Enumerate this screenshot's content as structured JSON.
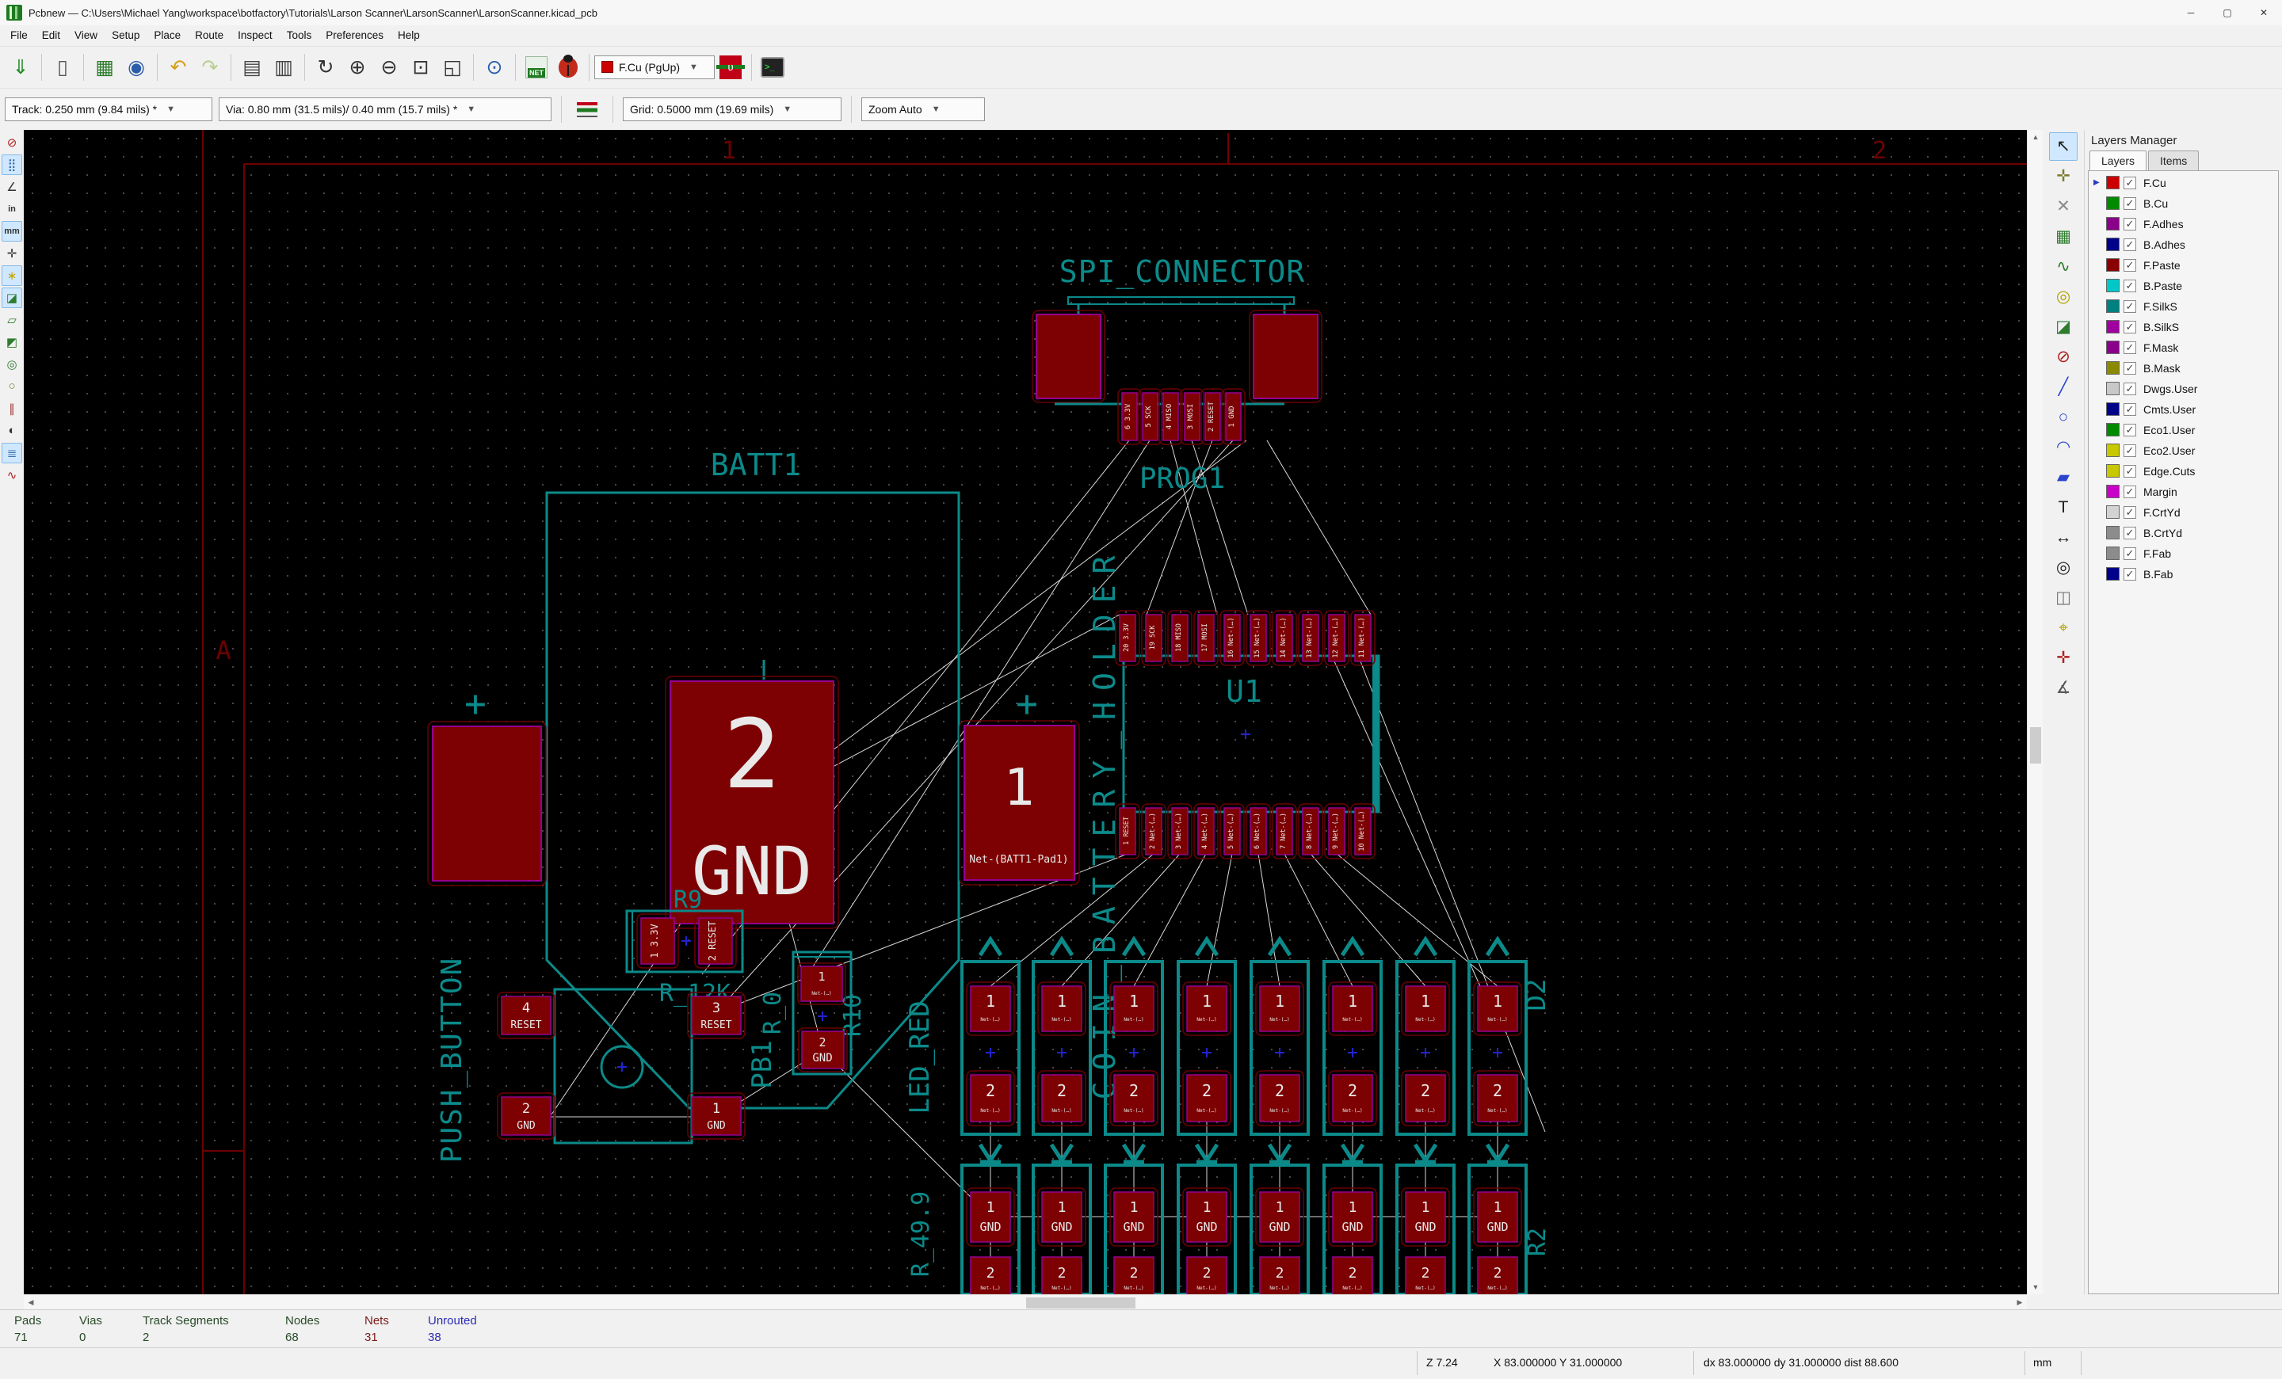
{
  "window": {
    "title": "Pcbnew — C:\\Users\\Michael Yang\\workspace\\botfactory\\Tutorials\\Larson Scanner\\LarsonScanner\\LarsonScanner.kicad_pcb",
    "minimize": "─",
    "maximize": "▢",
    "close": "✕"
  },
  "menu": [
    "File",
    "Edit",
    "View",
    "Setup",
    "Place",
    "Route",
    "Inspect",
    "Tools",
    "Preferences",
    "Help"
  ],
  "toolbar_main": {
    "icons_left": [
      {
        "name": "save-icon",
        "glyph": "⇓",
        "color": "#1f8a1f"
      },
      {
        "name": "page-settings-icon",
        "glyph": "▯",
        "color": "#555",
        "sep": true
      },
      {
        "name": "footprint-editor-icon",
        "glyph": "▦",
        "color": "#2e7d2e",
        "sep": true
      },
      {
        "name": "footprint-browser-icon",
        "glyph": "◉",
        "color": "#2a5caa"
      },
      {
        "name": "undo-icon",
        "glyph": "↶",
        "color": "#d4a017",
        "sep": true
      },
      {
        "name": "redo-icon",
        "glyph": "↷",
        "color": "#b9cf92"
      },
      {
        "name": "print-icon",
        "glyph": "▤",
        "color": "#444",
        "sep": true
      },
      {
        "name": "plot-icon",
        "glyph": "▥",
        "color": "#444"
      },
      {
        "name": "redraw-icon",
        "glyph": "↻",
        "color": "#333",
        "sep": true
      },
      {
        "name": "zoom-in-icon",
        "glyph": "⊕",
        "color": "#333"
      },
      {
        "name": "zoom-out-icon",
        "glyph": "⊖",
        "color": "#333"
      },
      {
        "name": "zoom-fit-icon",
        "glyph": "⊡",
        "color": "#333"
      },
      {
        "name": "zoom-selection-icon",
        "glyph": "◱",
        "color": "#333"
      },
      {
        "name": "find-icon",
        "glyph": "⊙",
        "color": "#2a5caa",
        "sep": true
      },
      {
        "name": "netlist-icon",
        "glyph": "NET",
        "special": "net",
        "sep": true
      },
      {
        "name": "drc-icon",
        "glyph": "",
        "special": "bug"
      }
    ],
    "layer_combo": "F.Cu (PgUp)",
    "icons_right": [
      {
        "name": "via-track-swap-icon",
        "glyph": "υ",
        "special": "via"
      },
      {
        "name": "scripting-console-icon",
        "glyph": ">_",
        "special": "console",
        "sep": true
      }
    ]
  },
  "toolbar_aux": {
    "track": "Track: 0.250 mm (9.84 mils) *",
    "via": "Via: 0.80 mm (31.5 mils)/ 0.40 mm (15.7 mils) *",
    "grid": "Grid: 0.5000 mm (19.69 mils)",
    "zoom": "Zoom Auto"
  },
  "left_toolbar": [
    {
      "name": "drc-off-icon",
      "glyph": "⊘",
      "color": "#b02020"
    },
    {
      "name": "grid-visibility-icon",
      "glyph": "⣿",
      "color": "#3a6ea5",
      "pressed": true
    },
    {
      "name": "polar-coords-icon",
      "glyph": "∠",
      "color": "#333"
    },
    {
      "name": "units-inch-icon",
      "glyph": "in",
      "color": "#333",
      "text": true
    },
    {
      "name": "units-mm-icon",
      "glyph": "mm",
      "color": "#333",
      "text": true,
      "pressed": true
    },
    {
      "name": "cursor-shape-icon",
      "glyph": "✛",
      "color": "#333"
    },
    {
      "name": "ratsnest-visibility-icon",
      "glyph": "∗",
      "color": "#c8a400",
      "pressed": true
    },
    {
      "name": "zones-filled-icon",
      "glyph": "◪",
      "color": "#2e7d2e",
      "pressed": true
    },
    {
      "name": "zones-outline-icon",
      "glyph": "▱",
      "color": "#2e7d2e"
    },
    {
      "name": "zones-sketch-icon",
      "glyph": "◩",
      "color": "#2e7d2e"
    },
    {
      "name": "pads-sketch-icon",
      "glyph": "◎",
      "color": "#2e7d2e"
    },
    {
      "name": "vias-sketch-icon",
      "glyph": "○",
      "color": "#7a7a2a"
    },
    {
      "name": "tracks-sketch-icon",
      "glyph": "∥",
      "color": "#a03030"
    },
    {
      "name": "high-contrast-icon",
      "glyph": "◐",
      "color": "#333"
    },
    {
      "name": "layers-panel-toggle-icon",
      "glyph": "≣",
      "color": "#3a6ea5",
      "pressed": true
    },
    {
      "name": "microwave-tools-icon",
      "glyph": "∿",
      "color": "#b02020"
    }
  ],
  "right_toolbar": [
    {
      "name": "select-tool-icon",
      "glyph": "↖",
      "color": "#222",
      "pressed": true
    },
    {
      "name": "highlight-net-icon",
      "glyph": "✛",
      "color": "#7a7a2a"
    },
    {
      "name": "local-ratsnest-icon",
      "glyph": "✕",
      "color": "#888"
    },
    {
      "name": "add-footprint-icon",
      "glyph": "▦",
      "color": "#2e7d2e"
    },
    {
      "name": "route-tracks-icon",
      "glyph": "∿",
      "color": "#2e7d2e"
    },
    {
      "name": "add-via-icon",
      "glyph": "◎",
      "color": "#b0a000"
    },
    {
      "name": "add-zone-icon",
      "glyph": "◪",
      "color": "#2e7d2e"
    },
    {
      "name": "add-keepout-icon",
      "glyph": "⊘",
      "color": "#b02020"
    },
    {
      "name": "add-graphic-line-icon",
      "glyph": "╱",
      "color": "#2a44cc"
    },
    {
      "name": "add-circle-icon",
      "glyph": "○",
      "color": "#2a44cc"
    },
    {
      "name": "add-arc-icon",
      "glyph": "◠",
      "color": "#2a44cc"
    },
    {
      "name": "add-polygon-icon",
      "glyph": "▰",
      "color": "#2a44cc"
    },
    {
      "name": "add-text-icon",
      "glyph": "T",
      "color": "#222"
    },
    {
      "name": "add-dimension-icon",
      "glyph": "↔",
      "color": "#222"
    },
    {
      "name": "add-target-icon",
      "glyph": "◎",
      "color": "#222"
    },
    {
      "name": "delete-tool-icon",
      "glyph": "◫",
      "color": "#777"
    },
    {
      "name": "drill-origin-icon",
      "glyph": "⌖",
      "color": "#b0a000"
    },
    {
      "name": "grid-origin-icon",
      "glyph": "✛",
      "color": "#b02020"
    },
    {
      "name": "measure-tool-icon",
      "glyph": "∡",
      "color": "#555"
    }
  ],
  "layers_manager": {
    "title": "Layers Manager",
    "tabs": [
      "Layers",
      "Items"
    ],
    "active_tab": "Layers",
    "check": "✓",
    "layers": [
      {
        "name": "F.Cu",
        "color": "#cc0000",
        "checked": true,
        "selected": true
      },
      {
        "name": "B.Cu",
        "color": "#008a00",
        "checked": true
      },
      {
        "name": "F.Adhes",
        "color": "#8a008a",
        "checked": true
      },
      {
        "name": "B.Adhes",
        "color": "#00008a",
        "checked": true
      },
      {
        "name": "F.Paste",
        "color": "#8a0000",
        "checked": true
      },
      {
        "name": "B.Paste",
        "color": "#00c8c8",
        "checked": true
      },
      {
        "name": "F.SilkS",
        "color": "#008080",
        "checked": true
      },
      {
        "name": "B.SilkS",
        "color": "#a000a0",
        "checked": true
      },
      {
        "name": "F.Mask",
        "color": "#8a008a",
        "checked": true
      },
      {
        "name": "B.Mask",
        "color": "#8a8a00",
        "checked": true
      },
      {
        "name": "Dwgs.User",
        "color": "#c8c8c8",
        "checked": true
      },
      {
        "name": "Cmts.User",
        "color": "#00008a",
        "checked": true
      },
      {
        "name": "Eco1.User",
        "color": "#008a00",
        "checked": true
      },
      {
        "name": "Eco2.User",
        "color": "#c8c800",
        "checked": true
      },
      {
        "name": "Edge.Cuts",
        "color": "#c8c800",
        "checked": true
      },
      {
        "name": "Margin",
        "color": "#c800c8",
        "checked": true
      },
      {
        "name": "F.CrtYd",
        "color": "#d3d3d3",
        "checked": true
      },
      {
        "name": "B.CrtYd",
        "color": "#8c8c8c",
        "checked": true
      },
      {
        "name": "F.Fab",
        "color": "#8c8c8c",
        "checked": true
      },
      {
        "name": "B.Fab",
        "color": "#00008a",
        "checked": true
      }
    ]
  },
  "canvas": {
    "sheet": {
      "col1": "1",
      "col2": "2",
      "row": "A"
    },
    "spi": {
      "title": "SPI_CONNECTOR",
      "ref": "PROG1",
      "pads": [
        "6 3.3V",
        "5 SCK",
        "4 MISO",
        "3 MOSI",
        "2 RESET",
        "1 GND"
      ]
    },
    "batt": {
      "ref": "BATT1",
      "holder": "COIN_BATTERY_HOLDER",
      "plus": "+",
      "pad2_num": "2",
      "pad2_name": "GND",
      "pad1_num": "1",
      "pad1_net": "Net-(BATT1-Pad1)"
    },
    "u1": {
      "ref": "U1",
      "top_pads": [
        [
          "20",
          "3.3V"
        ],
        [
          "19",
          "SCK"
        ],
        [
          "18",
          "MISO"
        ],
        [
          "17",
          "MOSI"
        ],
        [
          "16",
          "Net-(…)"
        ],
        [
          "15",
          "Net-(…)"
        ],
        [
          "14",
          "Net-(…)"
        ],
        [
          "13",
          "Net-(…)"
        ],
        [
          "12",
          "Net-(…)"
        ],
        [
          "11",
          "Net-(…)"
        ]
      ],
      "bottom_pads": [
        [
          "1",
          "RESET"
        ],
        [
          "2",
          "Net-(…)"
        ],
        [
          "3",
          "Net-(…)"
        ],
        [
          "4",
          "Net-(…)"
        ],
        [
          "5",
          "Net-(…)"
        ],
        [
          "6",
          "Net-(…)"
        ],
        [
          "7",
          "Net-(…)"
        ],
        [
          "8",
          "Net-(…)"
        ],
        [
          "9",
          "Net-(…)"
        ],
        [
          "10",
          "Net-(…)"
        ]
      ]
    },
    "r9": {
      "ref": "R9",
      "value": "R_12K",
      "pad1": "1 3.3V",
      "pad2": "2 RESET"
    },
    "button": {
      "label": "PUSH_BUTTON",
      "pads": [
        [
          "4",
          "RESET"
        ],
        [
          "3",
          "RESET"
        ],
        [
          "2",
          "GND"
        ],
        [
          "1",
          "GND"
        ]
      ]
    },
    "r10": {
      "ref": "R10",
      "value": "R_0",
      "pb": "PB1",
      "pad1_num": "1",
      "pad1_net": "Net-(…)",
      "pad2_num": "2",
      "pad2_name": "GND"
    },
    "led_row": {
      "label": "LED_RED",
      "right_label": "D2",
      "count": 8,
      "pad1_num": "1",
      "pad1_net": "Net-(…)",
      "pad2_num": "2",
      "pad2_net": "Net-(…)"
    },
    "res_row": {
      "label": "R_49.9",
      "right_label": "R2",
      "count": 8,
      "pad1_num": "1",
      "pad1_name": "GND",
      "pad2_num": "2",
      "pad2_net": "Net-(…)"
    }
  },
  "status_panel": {
    "items": [
      {
        "label": "Pads",
        "value": "71",
        "color": "#294a29"
      },
      {
        "label": "Vias",
        "value": "0",
        "color": "#294a29"
      },
      {
        "label": "Track Segments",
        "value": "2",
        "color": "#294a29"
      },
      {
        "label": "Nodes",
        "value": "68",
        "color": "#294a29"
      },
      {
        "label": "Nets",
        "value": "31",
        "color": "#7c1a1a"
      },
      {
        "label": "Unrouted",
        "value": "38",
        "color": "#2b2bb5"
      }
    ]
  },
  "status_bar": {
    "zoom": "Z 7.24",
    "pos": "X 83.000000  Y 31.000000",
    "delta": "dx 83.000000  dy 31.000000  dist 88.600",
    "units": "mm"
  },
  "colors": {
    "silk": "#0c8a8a",
    "pad": "#7d0102",
    "pad_outline": "#97008f",
    "clearance": "#6b0000",
    "ratsnest": "#ffffff",
    "sheet": "#6e0000",
    "grid_dot": "#7d7d7d"
  }
}
